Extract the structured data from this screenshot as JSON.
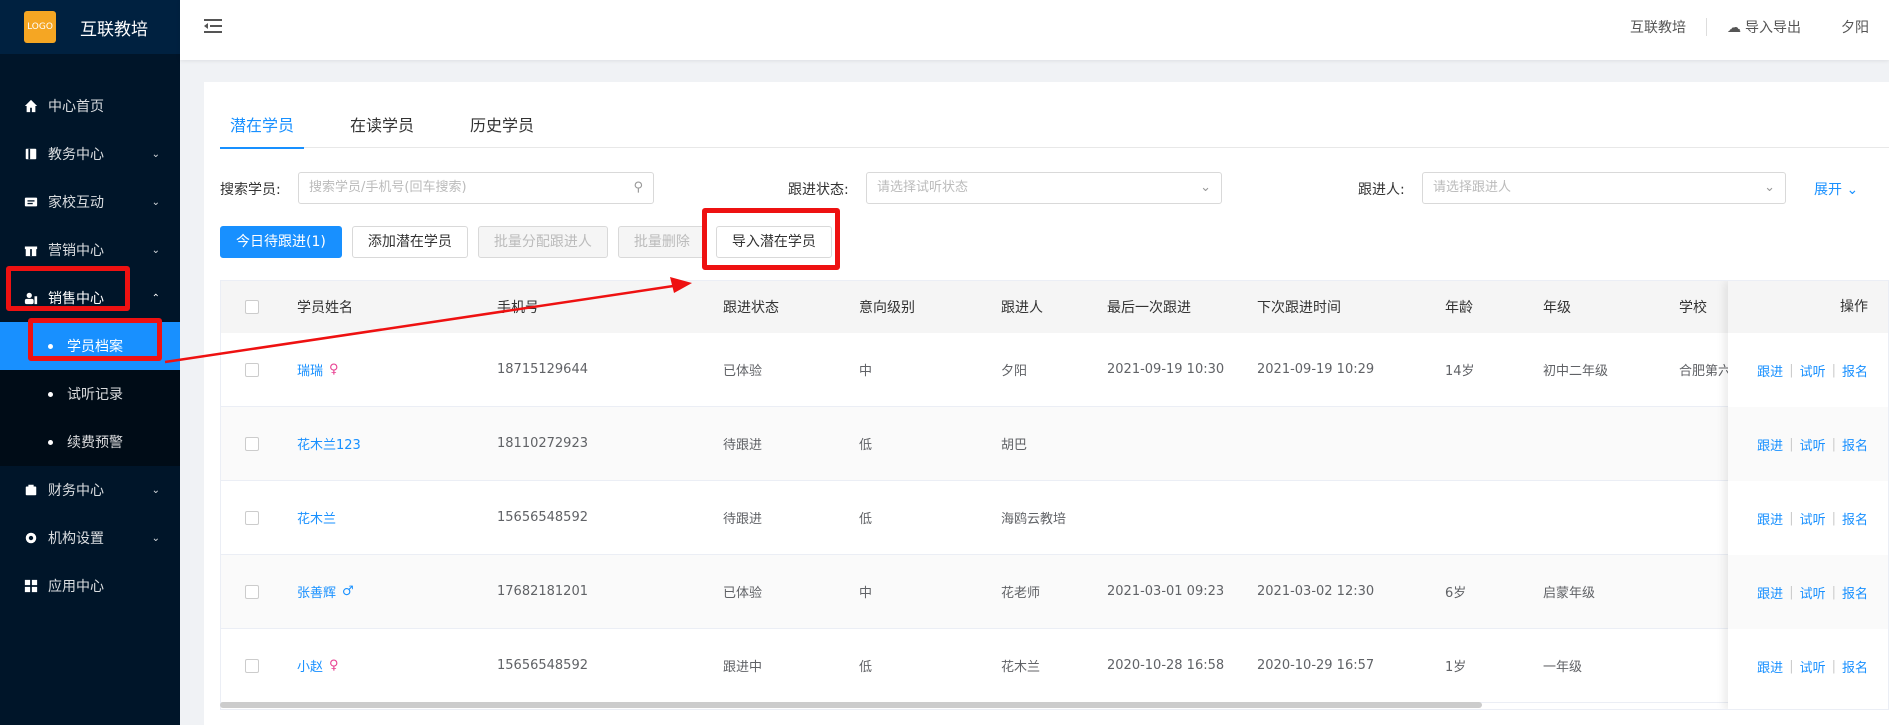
{
  "app": {
    "title": "互联教培",
    "logo_text": "互联教培"
  },
  "sidebar": {
    "items": [
      {
        "label": "中心首页",
        "icon": "home-icon"
      },
      {
        "label": "教务中心",
        "icon": "book-icon"
      },
      {
        "label": "家校互动",
        "icon": "message-icon"
      },
      {
        "label": "营销中心",
        "icon": "gift-icon"
      },
      {
        "label": "销售中心",
        "icon": "sales-icon"
      },
      {
        "label": "财务中心",
        "icon": "wallet-icon"
      },
      {
        "label": "机构设置",
        "icon": "gear-icon"
      },
      {
        "label": "应用中心",
        "icon": "grid-icon"
      }
    ],
    "sub_items": [
      {
        "label": "学员档案",
        "active": true
      },
      {
        "label": "试听记录"
      },
      {
        "label": "续费预警"
      }
    ]
  },
  "header": {
    "org": "互联教培",
    "import_export": "导入导出",
    "user": "夕阳"
  },
  "tabs": [
    {
      "label": "潜在学员"
    },
    {
      "label": "在读学员"
    },
    {
      "label": "历史学员"
    }
  ],
  "filters": {
    "search_label": "搜索学员:",
    "search_placeholder": "搜索学员/手机号(回车搜索)",
    "status_label": "跟进状态:",
    "status_placeholder": "请选择试听状态",
    "follower_label": "跟进人:",
    "follower_placeholder": "请选择跟进人",
    "expand": "展开"
  },
  "buttons": {
    "today": "今日待跟进(1)",
    "add": "添加潜在学员",
    "assign": "批量分配跟进人",
    "delete": "批量删除",
    "import": "导入潜在学员"
  },
  "table": {
    "columns": [
      "学员姓名",
      "手机号",
      "跟进状态",
      "意向级别",
      "跟进人",
      "最后一次跟进",
      "下次跟进时间",
      "年龄",
      "年级",
      "学校",
      "操作"
    ],
    "rows": [
      {
        "name": "瑞瑞",
        "gender": "♀",
        "phone": "18715129644",
        "status": "已体验",
        "level": "中",
        "follower": "夕阳",
        "last": "2021-09-19 10:30",
        "next": "2021-09-19 10:29",
        "age": "14岁",
        "grade": "初中二年级",
        "school": "合肥第六"
      },
      {
        "name": "花木兰123",
        "gender": "",
        "phone": "18110272923",
        "status": "待跟进",
        "level": "低",
        "follower": "胡巴",
        "last": "",
        "next": "",
        "age": "",
        "grade": "",
        "school": ""
      },
      {
        "name": "花木兰",
        "gender": "",
        "phone": "15656548592",
        "status": "待跟进",
        "level": "低",
        "follower": "海鸥云教培",
        "last": "",
        "next": "",
        "age": "",
        "grade": "",
        "school": ""
      },
      {
        "name": "张善辉",
        "gender": "♂",
        "phone": "17682181201",
        "status": "已体验",
        "level": "中",
        "follower": "花老师",
        "last": "2021-03-01 09:23",
        "next": "2021-03-02 12:30",
        "age": "6岁",
        "grade": "启蒙年级",
        "school": ""
      },
      {
        "name": "小赵",
        "gender": "♀",
        "phone": "15656548592",
        "status": "跟进中",
        "level": "低",
        "follower": "花木兰",
        "last": "2020-10-28 16:58",
        "next": "2020-10-29 16:57",
        "age": "1岁",
        "grade": "一年级",
        "school": ""
      }
    ],
    "actions": [
      "跟进",
      "试听",
      "报名"
    ]
  }
}
